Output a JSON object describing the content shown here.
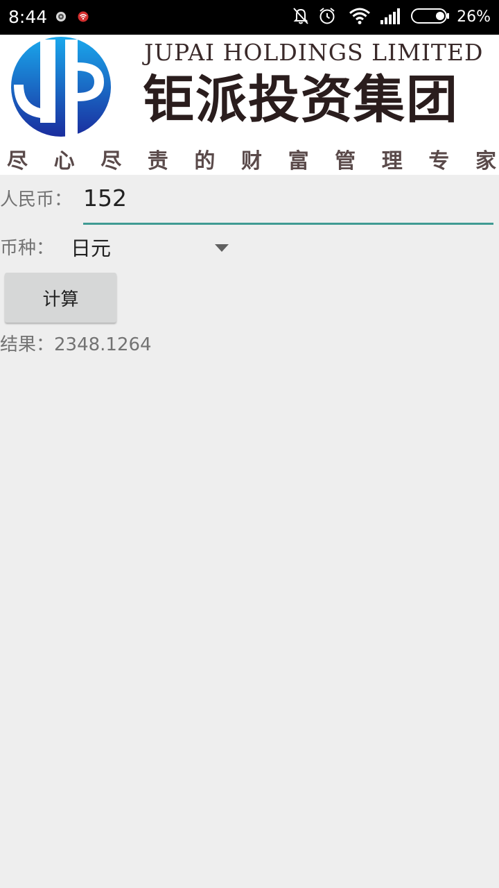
{
  "status_bar": {
    "time": "8:44",
    "battery_percent": "26%",
    "icons": [
      "notification-app-icon",
      "notification-wifi-app-icon",
      "notifications-muted-icon",
      "alarm-icon",
      "wifi-icon",
      "signal-icon",
      "battery-icon"
    ]
  },
  "banner": {
    "company_en": "JUPAI HOLDINGS LIMITED",
    "company_cn": "钜派投资集团",
    "slogan_chars": [
      "尽",
      "心",
      "尽",
      "责",
      "的",
      "财",
      "富",
      "管",
      "理",
      "专",
      "家"
    ],
    "logo_colors": [
      "#1aa3e8",
      "#1a3aa8"
    ]
  },
  "form": {
    "rmb_label": "人民币：",
    "rmb_value": "152",
    "currency_label": "币种：",
    "currency_selected": "日元",
    "calculate_label": "计算",
    "result_text": "结果：2348.1264"
  },
  "colors": {
    "accent": "#3f9a93",
    "background": "#eeeeee",
    "button": "#d6d7d7"
  }
}
